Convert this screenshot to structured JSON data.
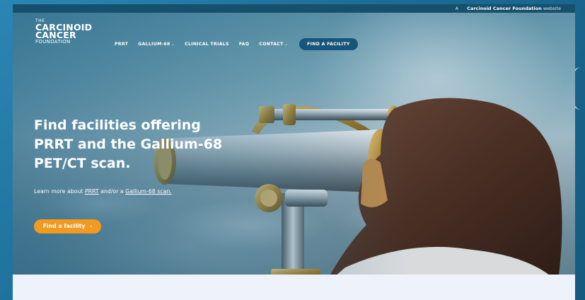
{
  "topbar": {
    "prefix": "A",
    "org": "Carcinoid Cancer Foundation",
    "suffix": "website"
  },
  "logo": {
    "the": "THE",
    "line1": "CARCINOID",
    "line2": "CANCER",
    "line3": "FOUNDATION"
  },
  "nav": {
    "items": [
      {
        "label": "PRRT",
        "dropdown": false
      },
      {
        "label": "GALLIUM-68",
        "dropdown": true
      },
      {
        "label": "CLINICAL TRIALS",
        "dropdown": false
      },
      {
        "label": "FAQ",
        "dropdown": false
      },
      {
        "label": "CONTACT",
        "dropdown": true
      }
    ],
    "caret": "⌄",
    "cta_label": "FIND A FACILITY"
  },
  "hero": {
    "headline_line1": "Find facilities offering",
    "headline_line2": "PRRT and the Gallium-68",
    "headline_line3": "PET/CT scan.",
    "sub_prefix": "Learn more about",
    "sub_link1": "PRRT",
    "sub_mid": "and/or a",
    "sub_link2": "Gallium-68 scan.",
    "button_label": "Find a facility",
    "button_icon": "›"
  },
  "colors": {
    "accent_orange": "#f29a1f",
    "nav_cta_blue": "#17557a",
    "topbar": "#17506c"
  }
}
